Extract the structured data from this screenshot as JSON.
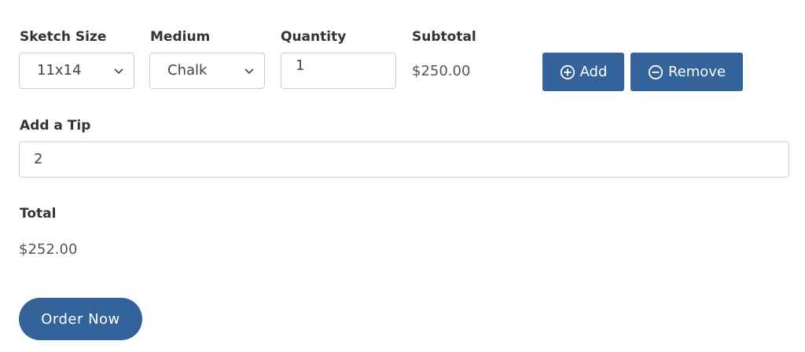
{
  "form": {
    "sketch_size": {
      "label": "Sketch Size",
      "value": "11x14"
    },
    "medium": {
      "label": "Medium",
      "value": "Chalk"
    },
    "quantity": {
      "label": "Quantity",
      "value": "1"
    },
    "subtotal": {
      "label": "Subtotal",
      "value": "$250.00"
    },
    "add_button": {
      "label": "Add",
      "icon": "plus-circle-icon"
    },
    "remove_button": {
      "label": "Remove",
      "icon": "minus-circle-icon"
    },
    "tip": {
      "label": "Add a Tip",
      "value": "2"
    },
    "total": {
      "label": "Total",
      "value": "$252.00"
    },
    "order_button": {
      "label": "Order Now"
    }
  },
  "colors": {
    "accent": "#33639a",
    "border": "#cfcfcf",
    "label_text": "#333333",
    "value_text": "#555555"
  }
}
